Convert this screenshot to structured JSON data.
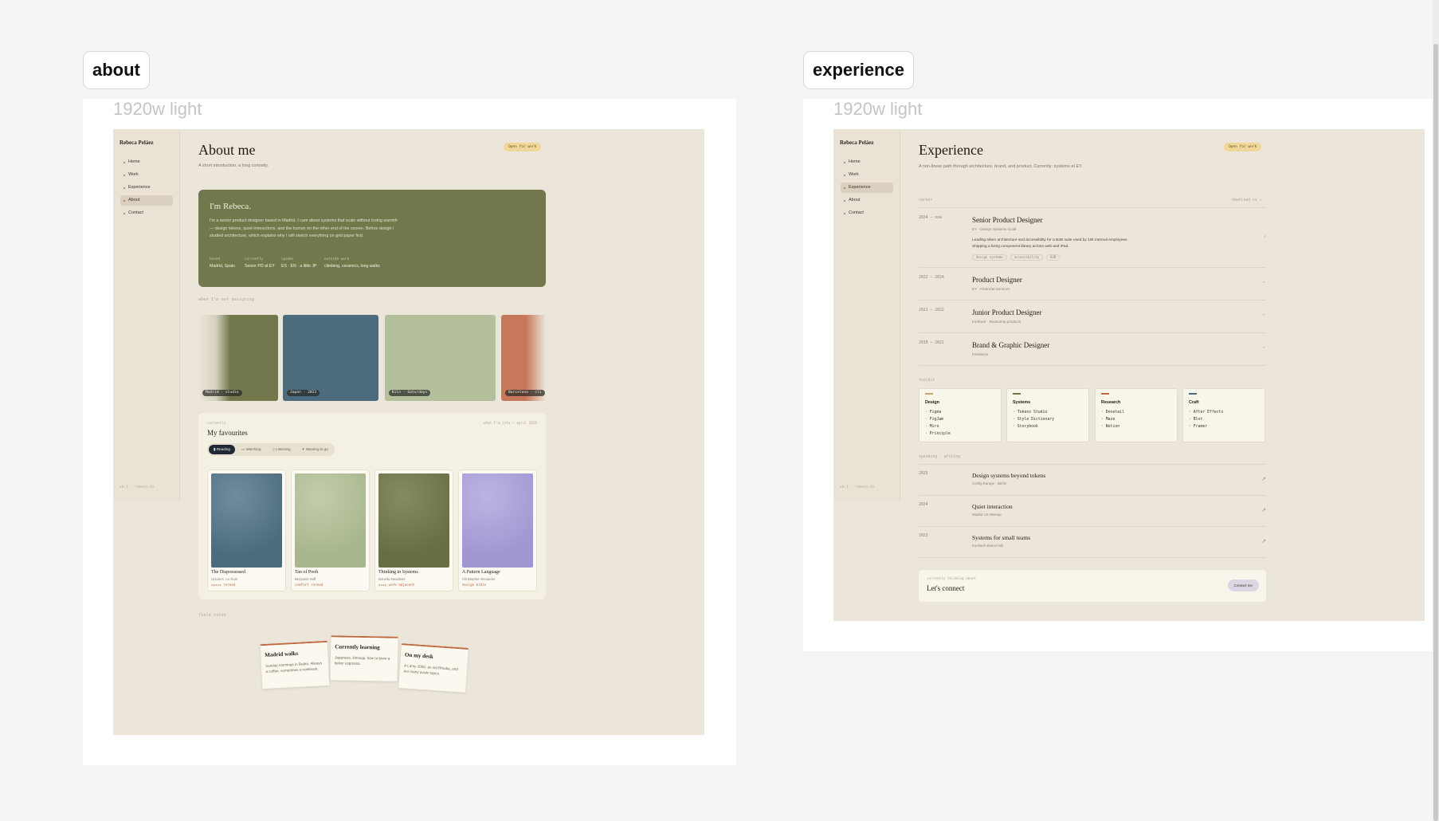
{
  "canvas": {
    "label": "1920w light"
  },
  "frames": {
    "about": {
      "tag": "about"
    },
    "experience": {
      "tag": "experience"
    }
  },
  "sidebar": {
    "brand": "Rebeca Peláez",
    "footer": "v0.1 · rebeca.do",
    "items": [
      {
        "label": "Home"
      },
      {
        "label": "Work"
      },
      {
        "label": "Experience"
      },
      {
        "label": "About"
      },
      {
        "label": "Contact"
      }
    ]
  },
  "status_pill": "Open for work",
  "about": {
    "title": "About me",
    "subtitle": "A short introduction, a long curiosity.",
    "hero": {
      "greeting": "I'm Rebeca.",
      "bio": "I'm a senior product designer based in Madrid. I care about systems that scale without losing warmth — design tokens, quiet interactions, and the human on the other end of the screen. Before design I studied architecture, which explains why I still sketch everything on grid paper first.",
      "facts": [
        {
          "key": "based",
          "value": "Madrid, Spain"
        },
        {
          "key": "currently",
          "value": "Senior PD at EY"
        },
        {
          "key": "speaks",
          "value": "ES · EN · a little JP"
        },
        {
          "key": "outside work",
          "value": "climbing, ceramics, long walks"
        }
      ]
    },
    "photos_label": "when I'm not designing",
    "photos": [
      {
        "caption": "Madrid · studio",
        "color": "#72784c"
      },
      {
        "caption": "Japan · 2023",
        "color": "#4c6b7d"
      },
      {
        "caption": "Kiln · Saturdays",
        "color": "#b4c09b"
      },
      {
        "caption": "Barcelona · cli",
        "color": "#c7775a"
      }
    ],
    "favourites": {
      "eyebrow": "currently",
      "title": "My favourites",
      "meta": "what I'm into — april 2025",
      "tabs": [
        {
          "label": "Reading",
          "icon": "book-icon"
        },
        {
          "label": "Watching",
          "icon": "screen-icon"
        },
        {
          "label": "Listening",
          "icon": "music-icon"
        },
        {
          "label": "Wanting to go",
          "icon": "plane-icon"
        }
      ],
      "books": [
        {
          "title": "The Dispossessed",
          "author": "Ursula K. Le Guin",
          "rating": "★★★★★ reread",
          "color": "#5a7a8c"
        },
        {
          "title": "Tao of Pooh",
          "author": "Benjamin Hoff",
          "rating": "comfort reread",
          "color": "#b4c09b"
        },
        {
          "title": "Thinking in Systems",
          "author": "Donella Meadows",
          "rating": "★★★★ work-adjacent",
          "color": "#72784c"
        },
        {
          "title": "A Pattern Language",
          "author": "Christopher Alexander",
          "rating": "design bible",
          "color": "#aaa0d6"
        }
      ]
    },
    "notes_label": "field notes",
    "notes": [
      {
        "title": "Madrid walks",
        "body": "Sunday mornings in Retiro. Always a coffee, sometimes a notebook."
      },
      {
        "title": "Currently learning",
        "body": "Japanese, kintsugi, how to brew a better espresso."
      },
      {
        "title": "On my desk",
        "body": "A Lamy 2000, an old Rhodia, and too many washi tapes."
      }
    ]
  },
  "experience": {
    "title": "Experience",
    "subtitle": "A non-linear path through architecture, brand, and product. Currently: systems at EY.",
    "career_label": "career",
    "download": "download cv ↓",
    "roles": [
      {
        "years": "2024 — now",
        "role": "Senior Product Designer",
        "company": "EY · Design Systems Guild",
        "description": "Leading token architecture and accessibility for a B2B suite used by 10k internal employees. Shipping a living component library across web and iPad.",
        "tags": [
          "design systems",
          "accessibility",
          "B2B"
        ]
      },
      {
        "years": "2022 — 2024",
        "role": "Product Designer",
        "company": "EY · Financial Services"
      },
      {
        "years": "2021 — 2022",
        "role": "Junior Product Designer",
        "company": "Ironhack · Bootcamp products"
      },
      {
        "years": "2019 — 2021",
        "role": "Brand & Graphic Designer",
        "company": "Freelance"
      }
    ],
    "toolkit_label": "toolkit",
    "toolkit": [
      {
        "title": "Design",
        "items": [
          "Figma",
          "FigJam",
          "Miro",
          "Principle"
        ],
        "accent": "#c7a76a"
      },
      {
        "title": "Systems",
        "items": [
          "Tokens Studio",
          "Style Dictionary",
          "Storybook"
        ],
        "accent": "#72784c"
      },
      {
        "title": "Research",
        "items": [
          "Dovetail",
          "Maze",
          "Notion"
        ],
        "accent": "#c0683e"
      },
      {
        "title": "Craft",
        "items": [
          "After Effects",
          "Blot",
          "Framer"
        ],
        "accent": "#4c6b7d"
      }
    ],
    "talks_label": "speaking · writing",
    "talks": [
      {
        "year": "2025",
        "name": "Design systems beyond tokens",
        "place": "Config Europe · Berlin"
      },
      {
        "year": "2024",
        "name": "Quiet interaction",
        "place": "Madrid UX Meetup"
      },
      {
        "year": "2023",
        "name": "Systems for small teams",
        "place": "Ironhack alumni talk"
      }
    ],
    "connect": {
      "eyebrow": "currently thinking about",
      "title": "Let's connect",
      "button": "Contact me"
    }
  }
}
